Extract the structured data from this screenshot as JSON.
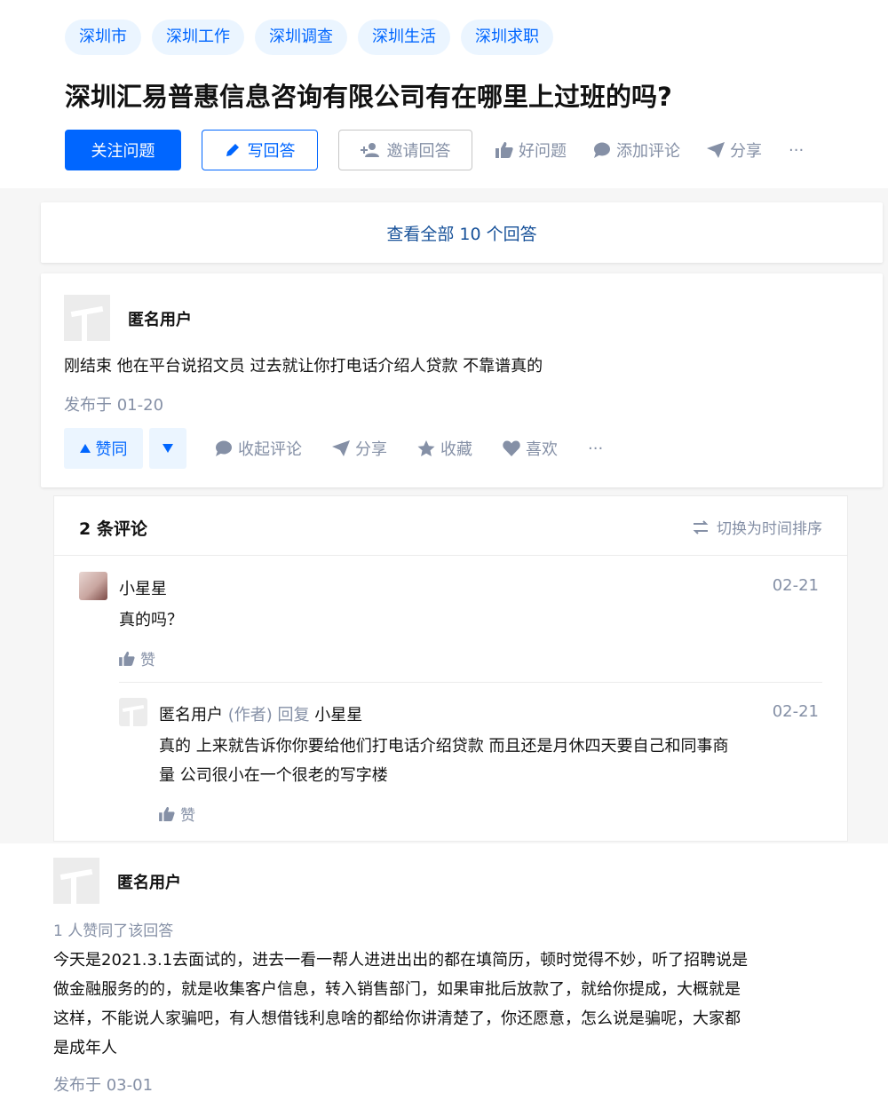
{
  "topics": [
    "深圳市",
    "深圳工作",
    "深圳调查",
    "深圳生活",
    "深圳求职"
  ],
  "question": {
    "title": "深圳汇易普惠信息咨询有限公司有在哪里上过班的吗?"
  },
  "actions": {
    "follow": "关注问题",
    "write": "写回答",
    "invite": "邀请回答",
    "good": "好问题",
    "add_comment": "添加评论",
    "share": "分享",
    "more": "···"
  },
  "view_all": "查看全部 10 个回答",
  "answer1": {
    "author": "匿名用户",
    "text": "刚结束 他在平台说招文员 过去就让你打电话介绍人贷款 不靠谱真的",
    "date": "发布于 01-20",
    "vote_up": "赞同",
    "collapse_comments": "收起评论",
    "share": "分享",
    "collect": "收藏",
    "like": "喜欢",
    "more": "···"
  },
  "comments": {
    "count": "2 条评论",
    "sort": "切换为时间排序",
    "items": [
      {
        "name": "小星星",
        "date": "02-21",
        "text": "真的吗？",
        "like": "赞"
      },
      {
        "name": "匿名用户",
        "author_tag": "(作者)",
        "reply_word": "回复",
        "reply_to": "小星星",
        "date": "02-21",
        "text_line1": "真的 上来就告诉你你要给他们打电话介绍贷款 而且还是月休四天要自己和同事商",
        "text_line2": "量 公司很小在一个很老的写字楼",
        "like": "赞"
      }
    ]
  },
  "answer2": {
    "author": "匿名用户",
    "votes": "1 人赞同了该回答",
    "lines": [
      "今天是2021.3.1去面试的，进去一看一帮人进进出出的都在填简历，顿时觉得不妙，听了招聘说是",
      "做金融服务的的，就是收集客户信息，转入销售部门，如果审批后放款了，就给你提成，大概就是",
      "这样，不能说人家骗吧，有人想借钱利息啥的都给你讲清楚了，你还愿意，怎么说是骗呢，大家都",
      "是成年人"
    ],
    "date": "发布于 03-01"
  },
  "colors": {
    "brand": "#0066ff",
    "brand_light": "#ebf5ff",
    "muted": "#8590a6",
    "link": "#175199"
  }
}
